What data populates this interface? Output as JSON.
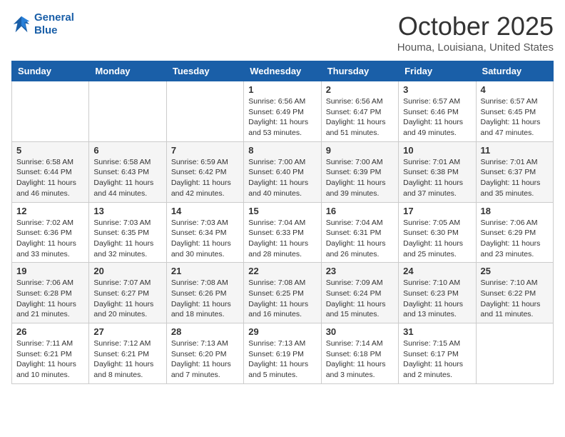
{
  "header": {
    "logo_line1": "General",
    "logo_line2": "Blue",
    "month": "October 2025",
    "location": "Houma, Louisiana, United States"
  },
  "weekdays": [
    "Sunday",
    "Monday",
    "Tuesday",
    "Wednesday",
    "Thursday",
    "Friday",
    "Saturday"
  ],
  "weeks": [
    [
      {
        "day": "",
        "info": ""
      },
      {
        "day": "",
        "info": ""
      },
      {
        "day": "",
        "info": ""
      },
      {
        "day": "1",
        "info": "Sunrise: 6:56 AM\nSunset: 6:49 PM\nDaylight: 11 hours and 53 minutes."
      },
      {
        "day": "2",
        "info": "Sunrise: 6:56 AM\nSunset: 6:47 PM\nDaylight: 11 hours and 51 minutes."
      },
      {
        "day": "3",
        "info": "Sunrise: 6:57 AM\nSunset: 6:46 PM\nDaylight: 11 hours and 49 minutes."
      },
      {
        "day": "4",
        "info": "Sunrise: 6:57 AM\nSunset: 6:45 PM\nDaylight: 11 hours and 47 minutes."
      }
    ],
    [
      {
        "day": "5",
        "info": "Sunrise: 6:58 AM\nSunset: 6:44 PM\nDaylight: 11 hours and 46 minutes."
      },
      {
        "day": "6",
        "info": "Sunrise: 6:58 AM\nSunset: 6:43 PM\nDaylight: 11 hours and 44 minutes."
      },
      {
        "day": "7",
        "info": "Sunrise: 6:59 AM\nSunset: 6:42 PM\nDaylight: 11 hours and 42 minutes."
      },
      {
        "day": "8",
        "info": "Sunrise: 7:00 AM\nSunset: 6:40 PM\nDaylight: 11 hours and 40 minutes."
      },
      {
        "day": "9",
        "info": "Sunrise: 7:00 AM\nSunset: 6:39 PM\nDaylight: 11 hours and 39 minutes."
      },
      {
        "day": "10",
        "info": "Sunrise: 7:01 AM\nSunset: 6:38 PM\nDaylight: 11 hours and 37 minutes."
      },
      {
        "day": "11",
        "info": "Sunrise: 7:01 AM\nSunset: 6:37 PM\nDaylight: 11 hours and 35 minutes."
      }
    ],
    [
      {
        "day": "12",
        "info": "Sunrise: 7:02 AM\nSunset: 6:36 PM\nDaylight: 11 hours and 33 minutes."
      },
      {
        "day": "13",
        "info": "Sunrise: 7:03 AM\nSunset: 6:35 PM\nDaylight: 11 hours and 32 minutes."
      },
      {
        "day": "14",
        "info": "Sunrise: 7:03 AM\nSunset: 6:34 PM\nDaylight: 11 hours and 30 minutes."
      },
      {
        "day": "15",
        "info": "Sunrise: 7:04 AM\nSunset: 6:33 PM\nDaylight: 11 hours and 28 minutes."
      },
      {
        "day": "16",
        "info": "Sunrise: 7:04 AM\nSunset: 6:31 PM\nDaylight: 11 hours and 26 minutes."
      },
      {
        "day": "17",
        "info": "Sunrise: 7:05 AM\nSunset: 6:30 PM\nDaylight: 11 hours and 25 minutes."
      },
      {
        "day": "18",
        "info": "Sunrise: 7:06 AM\nSunset: 6:29 PM\nDaylight: 11 hours and 23 minutes."
      }
    ],
    [
      {
        "day": "19",
        "info": "Sunrise: 7:06 AM\nSunset: 6:28 PM\nDaylight: 11 hours and 21 minutes."
      },
      {
        "day": "20",
        "info": "Sunrise: 7:07 AM\nSunset: 6:27 PM\nDaylight: 11 hours and 20 minutes."
      },
      {
        "day": "21",
        "info": "Sunrise: 7:08 AM\nSunset: 6:26 PM\nDaylight: 11 hours and 18 minutes."
      },
      {
        "day": "22",
        "info": "Sunrise: 7:08 AM\nSunset: 6:25 PM\nDaylight: 11 hours and 16 minutes."
      },
      {
        "day": "23",
        "info": "Sunrise: 7:09 AM\nSunset: 6:24 PM\nDaylight: 11 hours and 15 minutes."
      },
      {
        "day": "24",
        "info": "Sunrise: 7:10 AM\nSunset: 6:23 PM\nDaylight: 11 hours and 13 minutes."
      },
      {
        "day": "25",
        "info": "Sunrise: 7:10 AM\nSunset: 6:22 PM\nDaylight: 11 hours and 11 minutes."
      }
    ],
    [
      {
        "day": "26",
        "info": "Sunrise: 7:11 AM\nSunset: 6:21 PM\nDaylight: 11 hours and 10 minutes."
      },
      {
        "day": "27",
        "info": "Sunrise: 7:12 AM\nSunset: 6:21 PM\nDaylight: 11 hours and 8 minutes."
      },
      {
        "day": "28",
        "info": "Sunrise: 7:13 AM\nSunset: 6:20 PM\nDaylight: 11 hours and 7 minutes."
      },
      {
        "day": "29",
        "info": "Sunrise: 7:13 AM\nSunset: 6:19 PM\nDaylight: 11 hours and 5 minutes."
      },
      {
        "day": "30",
        "info": "Sunrise: 7:14 AM\nSunset: 6:18 PM\nDaylight: 11 hours and 3 minutes."
      },
      {
        "day": "31",
        "info": "Sunrise: 7:15 AM\nSunset: 6:17 PM\nDaylight: 11 hours and 2 minutes."
      },
      {
        "day": "",
        "info": ""
      }
    ]
  ]
}
